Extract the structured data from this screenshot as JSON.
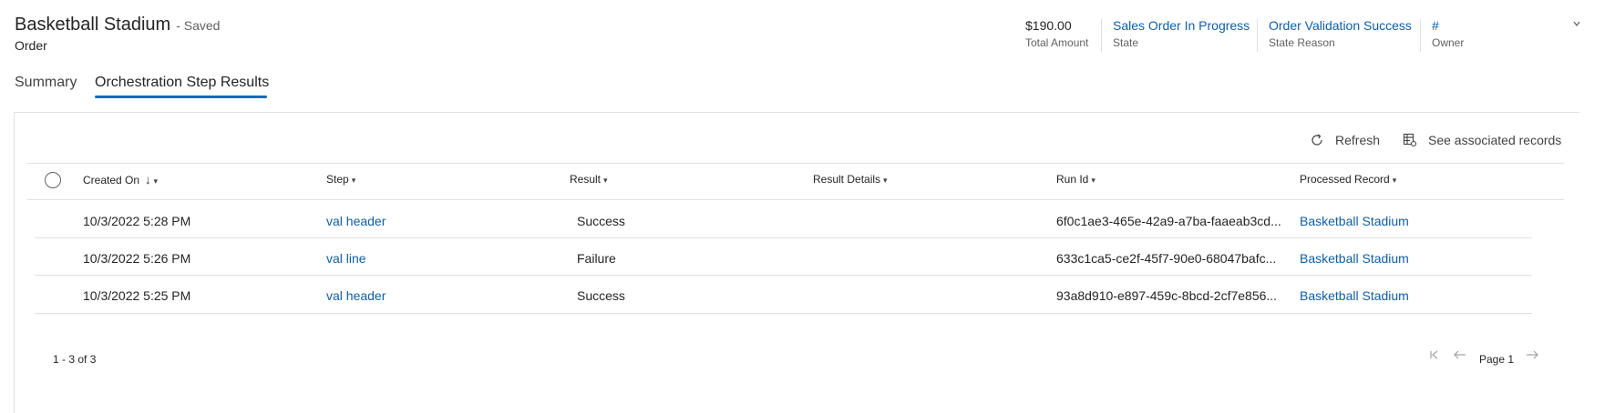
{
  "header": {
    "title": "Basketball Stadium",
    "saved_status": "- Saved",
    "entity": "Order",
    "fields": [
      {
        "value": "$190.00",
        "label": "Total Amount",
        "is_link": false
      },
      {
        "value": "Sales Order In Progress",
        "label": "State",
        "is_link": true
      },
      {
        "value": "Order Validation Success",
        "label": "State Reason",
        "is_link": true
      },
      {
        "value": "#",
        "label": "Owner",
        "is_link": true
      }
    ]
  },
  "tabs": [
    {
      "label": "Summary",
      "active": false
    },
    {
      "label": "Orchestration Step Results",
      "active": true
    }
  ],
  "commands": {
    "refresh": "Refresh",
    "associated": "See associated records"
  },
  "grid": {
    "columns": [
      "Created On",
      "Step",
      "Result",
      "Result Details",
      "Run Id",
      "Processed Record"
    ],
    "sort_column": "Created On",
    "sort_direction": "descending",
    "rows": [
      {
        "created_on": "10/3/2022 5:28 PM",
        "step": "val header",
        "result": "Success",
        "result_details": "",
        "run_id": "6f0c1ae3-465e-42a9-a7ba-faaeab3cd...",
        "processed_record": "Basketball Stadium"
      },
      {
        "created_on": "10/3/2022 5:26 PM",
        "step": "val line",
        "result": "Failure",
        "result_details": "",
        "run_id": "633c1ca5-ce2f-45f7-90e0-68047bafc...",
        "processed_record": "Basketball Stadium"
      },
      {
        "created_on": "10/3/2022 5:25 PM",
        "step": "val header",
        "result": "Success",
        "result_details": "",
        "run_id": "93a8d910-e897-459c-8bcd-2cf7e856...",
        "processed_record": "Basketball Stadium"
      }
    ]
  },
  "footer": {
    "record_count": "1 - 3 of 3",
    "page_label": "Page 1"
  },
  "colors": {
    "accent": "#0f6cbd",
    "link": "#115ea3",
    "divider": "#e0e0e0"
  },
  "icons": [
    "refresh-icon",
    "associated-records-icon",
    "select-all-circle-icon",
    "sort-descending-icon",
    "chevron-down-icon",
    "first-page-icon",
    "previous-page-icon",
    "next-page-icon",
    "collapse-header-icon"
  ]
}
